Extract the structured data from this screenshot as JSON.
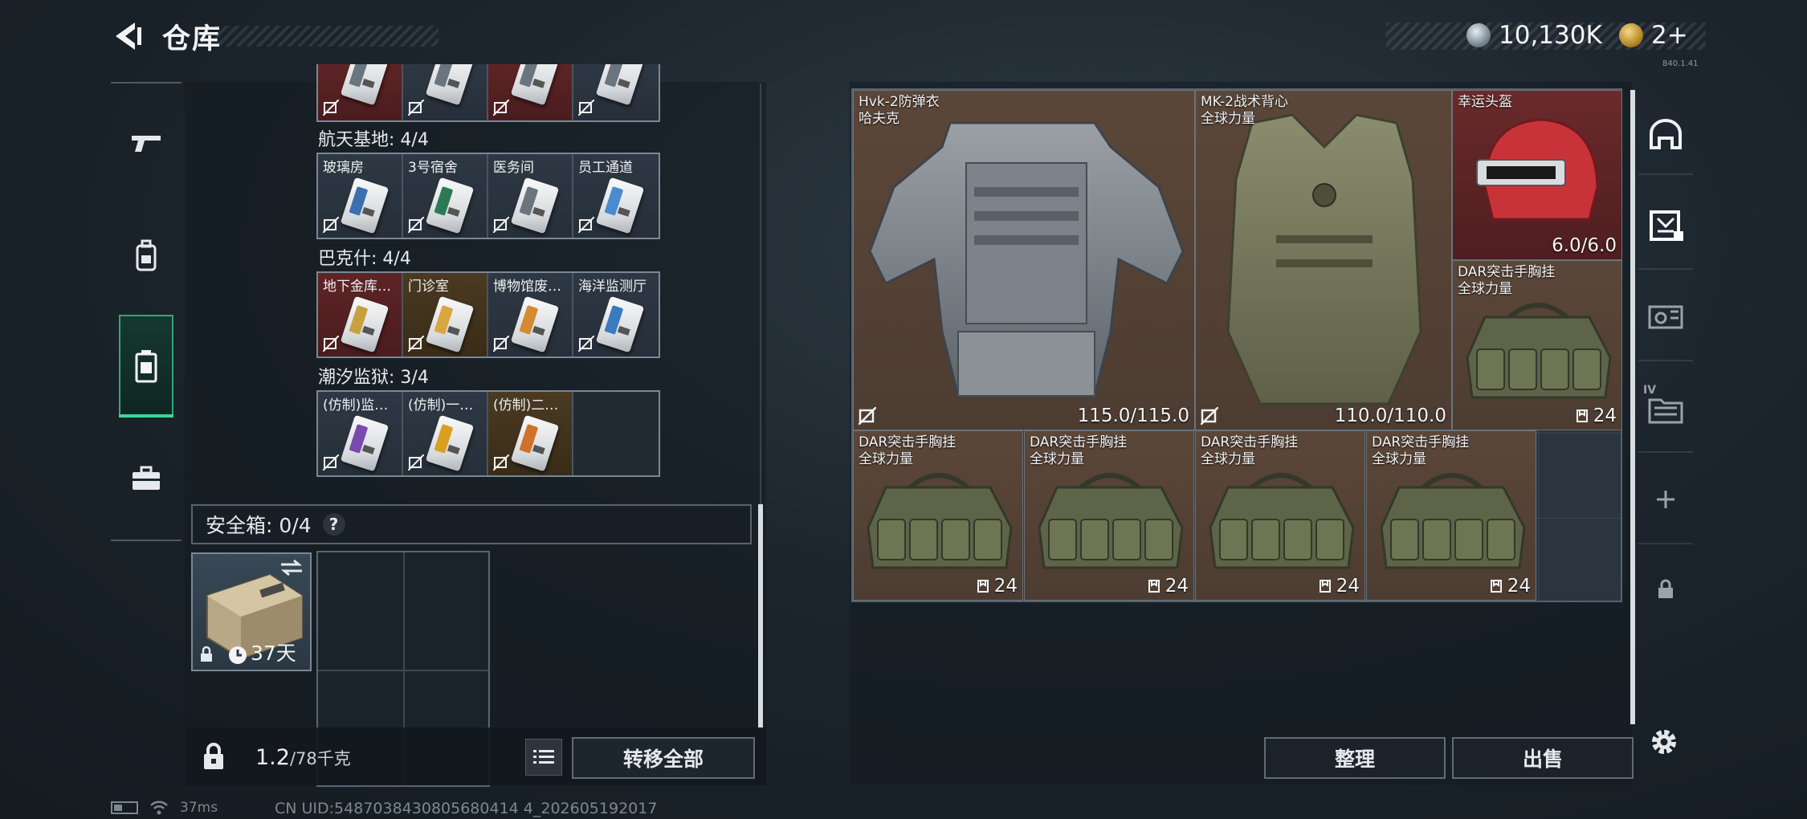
{
  "header": {
    "title": "仓库",
    "currency_1": "10,130K",
    "currency_2": "2+",
    "version": "840.1.41"
  },
  "left_nav": {
    "items": [
      "gun-icon",
      "backpack-icon",
      "keycard-case-icon",
      "briefcase-icon"
    ],
    "active_index": 2
  },
  "key_sections": [
    {
      "label": "",
      "cards": [
        {
          "name": "",
          "style": "red"
        },
        {
          "name": "",
          "style": "normal"
        },
        {
          "name": "",
          "style": "red"
        },
        {
          "name": "",
          "style": "normal"
        }
      ]
    },
    {
      "label": "航天基地: 4/4",
      "cards": [
        {
          "name": "玻璃房",
          "style": "normal",
          "stripe": "#3b6fb0"
        },
        {
          "name": "3号宿舍",
          "style": "normal",
          "stripe": "#2b7a55"
        },
        {
          "name": "医务间",
          "style": "normal",
          "stripe": "#6b7580"
        },
        {
          "name": "员工通道",
          "style": "normal",
          "stripe": "#4a8ad0"
        }
      ]
    },
    {
      "label": "巴克什: 4/4",
      "cards": [
        {
          "name": "地下金库…",
          "style": "red",
          "stripe": "#c9a040"
        },
        {
          "name": "门诊室",
          "style": "gold",
          "stripe": "#d9a640"
        },
        {
          "name": "博物馆废…",
          "style": "normal",
          "stripe": "#d48a30"
        },
        {
          "name": "海洋监测厅",
          "style": "normal",
          "stripe": "#3a7ac0"
        }
      ]
    },
    {
      "label": "潮汐监狱: 3/4",
      "cards": [
        {
          "name": "(仿制)监…",
          "style": "normal",
          "stripe": "#7a4ab0"
        },
        {
          "name": "(仿制)一…",
          "style": "normal",
          "stripe": "#d9a020"
        },
        {
          "name": "(仿制)二…",
          "style": "gold",
          "stripe": "#d0702a"
        },
        {
          "name": "",
          "style": "empty"
        }
      ]
    }
  ],
  "safe_box": {
    "label": "安全箱: 0/4",
    "help": "?",
    "timer": "37天"
  },
  "left_bottom": {
    "weight_current": "1.2",
    "weight_max": "/78千克",
    "transfer_all": "转移全部"
  },
  "inventory": [
    {
      "name": "Hvk-2防弹衣",
      "sub": "哈夫克",
      "durability": "115.0/115.0",
      "kind": "armor"
    },
    {
      "name": "MK-2战术背心",
      "sub": "全球力量",
      "durability": "110.0/110.0",
      "kind": "vest"
    },
    {
      "name": "幸运头盔",
      "sub": "",
      "durability": "6.0/6.0",
      "kind": "helmet"
    },
    {
      "name": "DAR突击手胸挂",
      "sub": "全球力量",
      "capacity": "24",
      "kind": "rig"
    },
    {
      "name": "DAR突击手胸挂",
      "sub": "全球力量",
      "capacity": "24",
      "kind": "rig"
    },
    {
      "name": "DAR突击手胸挂",
      "sub": "全球力量",
      "capacity": "24",
      "kind": "rig"
    },
    {
      "name": "DAR突击手胸挂",
      "sub": "全球力量",
      "capacity": "24",
      "kind": "rig"
    },
    {
      "name": "DAR突击手胸挂",
      "sub": "全球力量",
      "capacity": "24",
      "kind": "rig"
    }
  ],
  "right_nav": {
    "items": [
      "helmet-slot-icon",
      "armor-slot-icon",
      "vehicle-icon",
      "stash-iv-icon",
      "plus-icon",
      "lock-icon"
    ],
    "active_index": 1,
    "stash_label": "IV"
  },
  "right_bottom": {
    "sort": "整理",
    "sell": "出售"
  },
  "footer": {
    "ping": "37ms",
    "uid": "CN UID:5487038430805680414 4_202605192017"
  }
}
